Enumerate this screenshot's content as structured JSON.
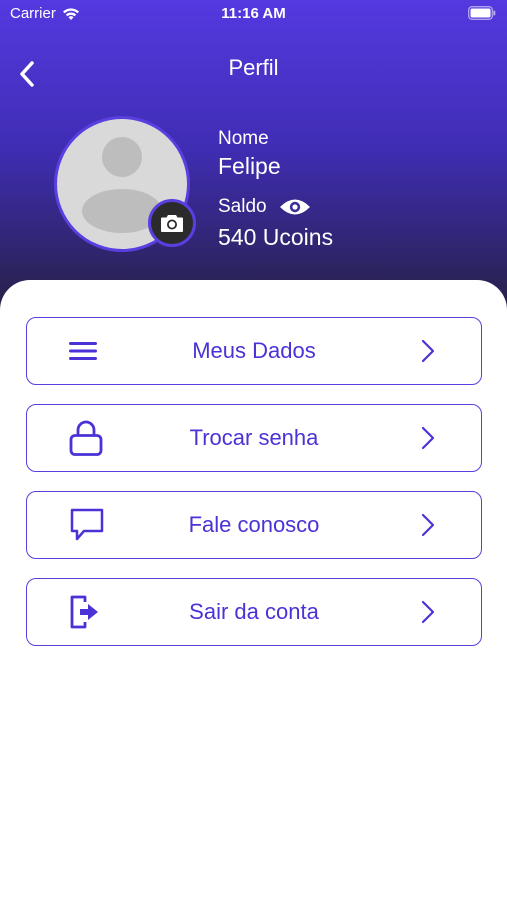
{
  "status_bar": {
    "carrier": "Carrier",
    "time": "11:16 AM"
  },
  "header": {
    "title": "Perfil",
    "back_icon": "chevron-left-icon"
  },
  "profile": {
    "name_label": "Nome",
    "name": "Felipe",
    "balance_label": "Saldo",
    "balance": "540 Ucoins",
    "avatar_icon": "user-placeholder-icon",
    "camera_icon": "camera-icon",
    "eye_icon": "eye-icon"
  },
  "menu": [
    {
      "label": "Meus Dados",
      "icon": "menu-lines-icon"
    },
    {
      "label": "Trocar senha",
      "icon": "lock-icon"
    },
    {
      "label": "Fale conosco",
      "icon": "chat-bubble-icon"
    },
    {
      "label": "Sair da conta",
      "icon": "logout-icon"
    }
  ],
  "colors": {
    "accent": "#5a3fe0",
    "text_accent": "#4a33d6",
    "gradient_top": "#5439e0",
    "gradient_bottom": "#231f38"
  }
}
